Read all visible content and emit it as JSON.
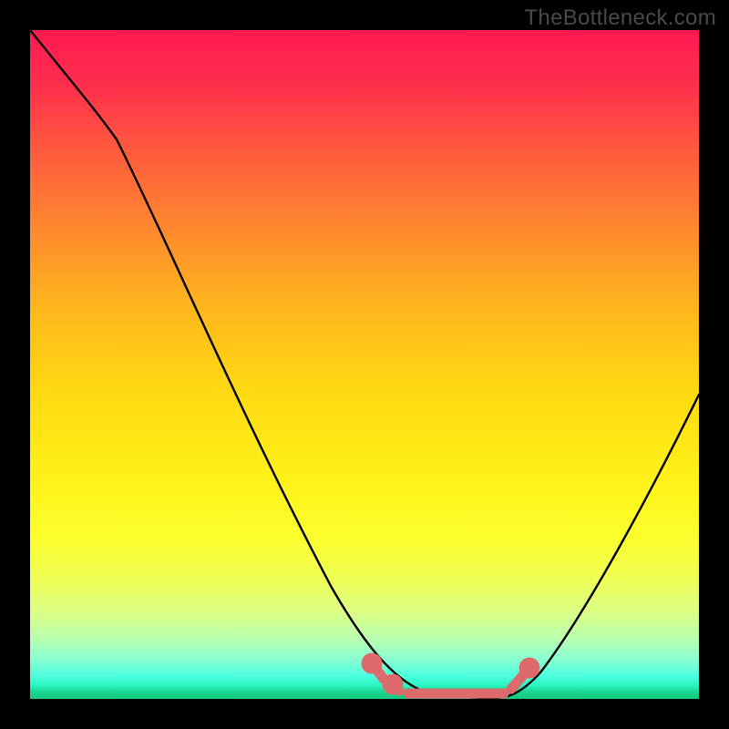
{
  "watermark": "TheBottleneck.com",
  "chart_data": {
    "type": "line",
    "title": "",
    "xlabel": "",
    "ylabel": "",
    "xlim": [
      0,
      100
    ],
    "ylim": [
      0,
      100
    ],
    "description": "Bottleneck percentage curve over a red-to-green vertical gradient. Y-axis encodes bottleneck % (red = high, green = 0). The black curve starts near 100% at the left, sweeps down to a flat minimum of ~0% around x=57–72, then rises toward ~50% at the right edge. A short salmon band highlights the flat optimal region.",
    "series": [
      {
        "name": "bottleneck_curve",
        "color": "#000000",
        "x": [
          0,
          5,
          10,
          15,
          20,
          25,
          30,
          35,
          40,
          45,
          50,
          55,
          57,
          60,
          65,
          70,
          72,
          75,
          80,
          85,
          90,
          95,
          100
        ],
        "y": [
          100,
          95,
          88,
          80,
          72,
          63,
          53,
          43,
          33,
          23,
          14,
          5,
          2,
          0,
          0,
          0,
          2,
          7,
          15,
          24,
          33,
          42,
          50
        ]
      },
      {
        "name": "optimal_region_marker",
        "color": "#e06666",
        "x": [
          50,
          52,
          55,
          58,
          62,
          66,
          70,
          73,
          75
        ],
        "y": [
          6,
          4,
          2,
          1,
          0,
          0,
          1,
          3,
          6
        ]
      }
    ],
    "gradient_stops": [
      {
        "pos": 0.0,
        "color": "#ff1a52"
      },
      {
        "pos": 0.5,
        "color": "#ffe11a"
      },
      {
        "pos": 0.85,
        "color": "#e8ff60"
      },
      {
        "pos": 1.0,
        "color": "#15c87f"
      }
    ]
  }
}
